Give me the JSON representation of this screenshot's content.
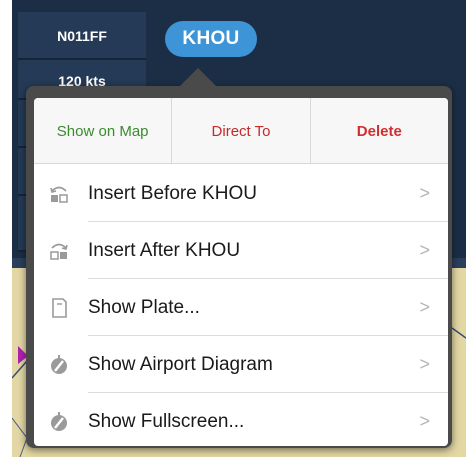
{
  "sidebar": {
    "items": [
      {
        "label": "N011FF"
      },
      {
        "label": "120 kts"
      }
    ]
  },
  "route": {
    "waypoint_label": "KHOU"
  },
  "popover": {
    "tabs": [
      {
        "label": "Show on Map",
        "color": "#3b8a2e"
      },
      {
        "label": "Direct To",
        "color": "#c42a2a"
      },
      {
        "label": "Delete",
        "color": "#d12f2f"
      }
    ],
    "menu_items": [
      {
        "label": "Insert Before KHOU",
        "icon": "insert-before-icon"
      },
      {
        "label": "Insert After KHOU",
        "icon": "insert-after-icon"
      },
      {
        "label": "Show Plate...",
        "icon": "plate-icon"
      },
      {
        "label": "Show Airport Diagram",
        "icon": "airport-diagram-icon"
      },
      {
        "label": "Show Fullscreen...",
        "icon": "fullscreen-icon"
      }
    ],
    "chevron": ">"
  },
  "colors": {
    "accent": "#3d94d6",
    "background": "#1c2e45",
    "map": "#e3d7a4"
  }
}
